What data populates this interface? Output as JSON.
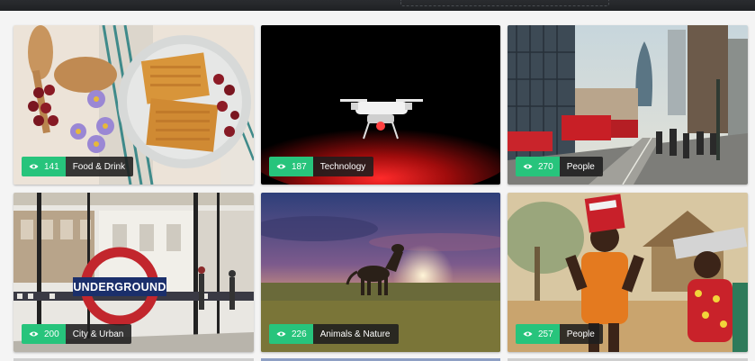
{
  "grid": {
    "cards": [
      {
        "views": "141",
        "category": "Food & Drink",
        "icon": "eye-icon"
      },
      {
        "views": "187",
        "category": "Technology",
        "icon": "eye-icon"
      },
      {
        "views": "270",
        "category": "People",
        "icon": "eye-icon"
      },
      {
        "views": "200",
        "category": "City & Urban",
        "icon": "eye-icon",
        "sign_text": "UNDERGROUND"
      },
      {
        "views": "226",
        "category": "Animals & Nature",
        "icon": "eye-icon"
      },
      {
        "views": "257",
        "category": "People",
        "icon": "eye-icon"
      }
    ]
  },
  "colors": {
    "views_badge": "#27c47c",
    "category_badge": "#1e1e1e",
    "page_background": "#f4f4f4",
    "top_bar": "#1f2124"
  }
}
